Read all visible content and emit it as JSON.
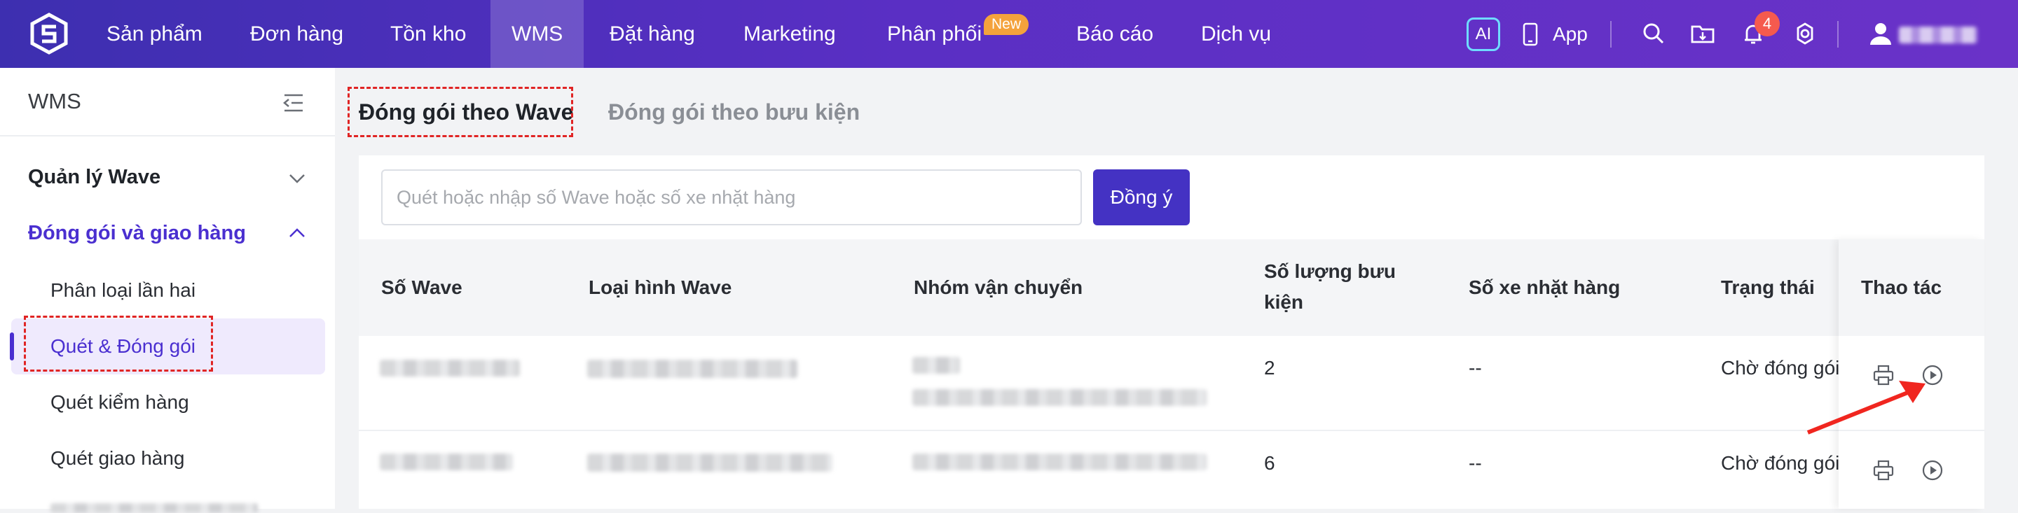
{
  "topnav": {
    "items": [
      {
        "label": "Sản phẩm"
      },
      {
        "label": "Đơn hàng"
      },
      {
        "label": "Tồn kho"
      },
      {
        "label": "WMS"
      },
      {
        "label": "Đặt hàng"
      },
      {
        "label": "Marketing"
      },
      {
        "label": "Phân phối"
      },
      {
        "label": "Báo cáo"
      },
      {
        "label": "Dịch vụ"
      }
    ],
    "active": "WMS",
    "new_badge": "New",
    "ai_label": "AI",
    "app_label": "App",
    "notification_count": "4",
    "icons": [
      "logo-icon",
      "ai-icon",
      "phone-icon",
      "search-icon",
      "folder-icon",
      "bell-icon",
      "gear-icon",
      "user-icon"
    ]
  },
  "sidebar": {
    "title": "WMS",
    "groups": [
      {
        "label": "Quản lý Wave",
        "expanded": false
      },
      {
        "label": "Đóng gói và giao hàng",
        "expanded": true,
        "items": [
          {
            "label": "Phân loại lần hai"
          },
          {
            "label": "Quét & Đóng gói"
          },
          {
            "label": "Quét kiểm hàng"
          },
          {
            "label": "Quét giao hàng"
          }
        ]
      }
    ],
    "active_item": "Quét & Đóng gói"
  },
  "main": {
    "tabs": [
      {
        "label": "Đóng gói theo Wave"
      },
      {
        "label": "Đóng gói theo bưu kiện"
      }
    ],
    "active_tab": "Đóng gói theo Wave",
    "search": {
      "placeholder": "Quét hoặc nhập số Wave hoặc số xe nhặt hàng",
      "value": ""
    },
    "confirm_label": "Đồng ý",
    "table": {
      "headers": [
        "Số Wave",
        "Loại hình Wave",
        "Nhóm vận chuyển",
        "Số lượng bưu kiện",
        "Số xe nhặt hàng",
        "Trạng thái",
        "Thao tác"
      ],
      "header_qty_line1": "Số lượng bưu",
      "header_qty_line2": "kiện",
      "rows": [
        {
          "qty": "2",
          "cart": "--",
          "status": "Chờ đóng gói"
        },
        {
          "qty": "6",
          "cart": "--",
          "status": "Chờ đóng gói"
        }
      ]
    }
  },
  "colors": {
    "primary": "#4432c3",
    "highlight": "#e02424",
    "active_bg": "#efeafd"
  }
}
